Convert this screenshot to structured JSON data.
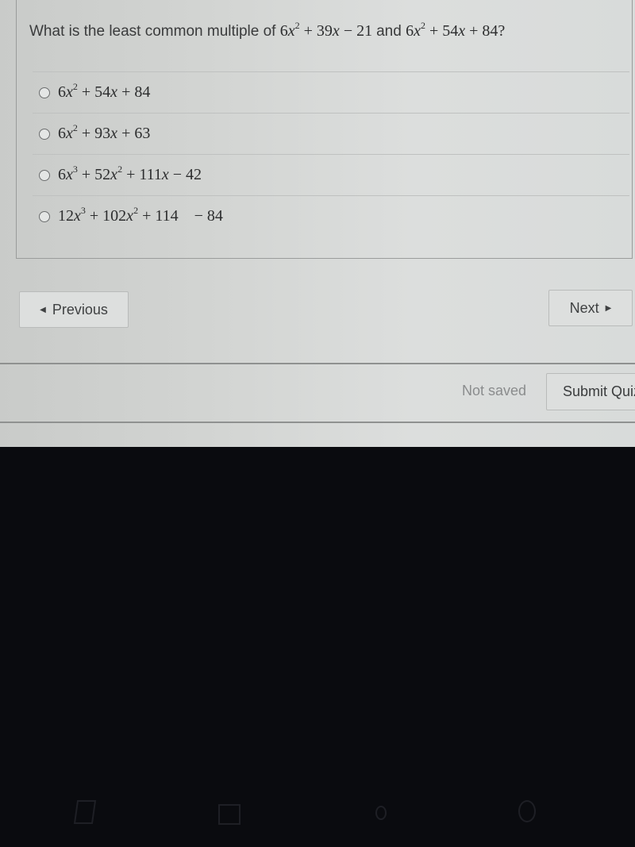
{
  "question": {
    "prefix": "What is the least common multiple of",
    "poly1": {
      "a": "6",
      "var": "x",
      "exp": "2",
      "rest": " + 39",
      "var2": "x",
      "tail": " − 21"
    },
    "joiner": "and",
    "poly2": {
      "a": "6",
      "var": "x",
      "exp": "2",
      "rest": " + 54",
      "var2": "x",
      "tail": " + 84?"
    }
  },
  "options": [
    {
      "selected": false,
      "terms": [
        {
          "coef": "6",
          "var": "x",
          "exp": "2"
        },
        {
          "text": " + 54"
        },
        {
          "var": "x"
        },
        {
          "text": " + 84"
        }
      ]
    },
    {
      "selected": false,
      "terms": [
        {
          "coef": "6",
          "var": "x",
          "exp": "2"
        },
        {
          "text": " + 93"
        },
        {
          "var": "x"
        },
        {
          "text": " + 63"
        }
      ]
    },
    {
      "selected": false,
      "terms": [
        {
          "coef": "6",
          "var": "x",
          "exp": "3"
        },
        {
          "text": " + 52"
        },
        {
          "var": "x",
          "exp": "2"
        },
        {
          "text": " + 111"
        },
        {
          "var": "x"
        },
        {
          "text": " − 42"
        }
      ]
    },
    {
      "selected": false,
      "terms": [
        {
          "coef": "12",
          "var": "x",
          "exp": "3"
        },
        {
          "text": " + 102"
        },
        {
          "var": "x",
          "exp": "2"
        },
        {
          "text": " + 114    − 84"
        }
      ]
    }
  ],
  "nav": {
    "previous_label": "Previous",
    "next_label": "Next",
    "previous_icon": "triangle-left-icon",
    "next_icon": "triangle-right-icon"
  },
  "footer": {
    "status": "Not saved",
    "submit_label": "Submit Quiz"
  }
}
